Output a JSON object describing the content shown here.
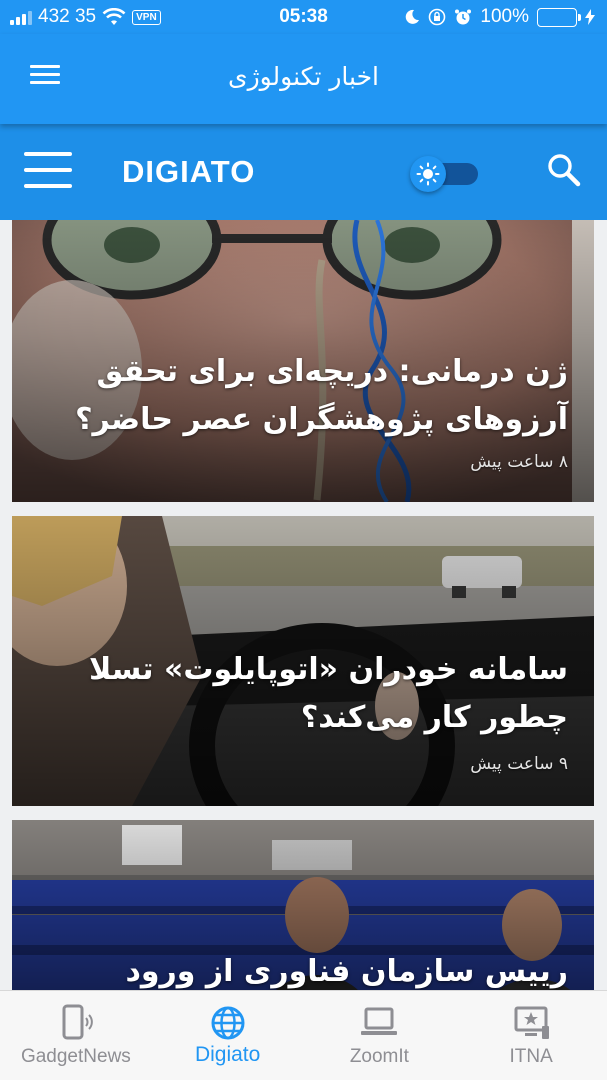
{
  "status_bar": {
    "carrier": "432 35",
    "vpn": "VPN",
    "time": "05:38",
    "battery": "100%",
    "battery_level": 1.0,
    "icons": [
      "signal-icon",
      "wifi-icon",
      "vpn-badge",
      "moon-icon",
      "lock-rotation-icon",
      "alarm-icon",
      "battery-icon",
      "charging-icon"
    ]
  },
  "app_bar": {
    "title": "اخبار تکنولوژی"
  },
  "site_bar": {
    "logo": "DIGIATO",
    "theme_toggle_on": false
  },
  "articles": [
    {
      "headline": "ژن درمانی: دریچه‌ای برای تحقق آرزوهای پژوهشگران عصر حاضر؟",
      "time": "۸ ساعت پیش"
    },
    {
      "headline": "سامانه خودران «اتوپایلوت» تسلا چطور کار می‌کند؟",
      "time": "۹ ساعت پیش"
    },
    {
      "headline": "رییس سازمان فناوری از ورود مباحث",
      "time": ""
    }
  ],
  "tabs": [
    {
      "label": "GadgetNews",
      "icon": "phone-icon",
      "active": false
    },
    {
      "label": "Digiato",
      "icon": "globe-icon",
      "active": true
    },
    {
      "label": "ZoomIt",
      "icon": "laptop-icon",
      "active": false
    },
    {
      "label": "ITNA",
      "icon": "tv-star-icon",
      "active": false
    }
  ],
  "colors": {
    "primary": "#2196f3",
    "site_bar": "#1e8fe8",
    "tab_inactive": "#8e8e93",
    "battery": "#4cd964"
  }
}
